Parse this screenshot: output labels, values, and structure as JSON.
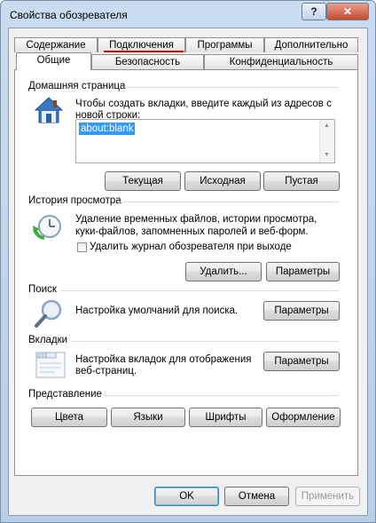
{
  "window": {
    "title": "Свойства обозревателя",
    "help_glyph": "?",
    "close_glyph": "✕"
  },
  "tabs_row1": [
    {
      "label": "Содержание"
    },
    {
      "label": "Подключения"
    },
    {
      "label": "Программы"
    },
    {
      "label": "Дополнительно"
    }
  ],
  "tabs_row2": [
    {
      "label": "Общие"
    },
    {
      "label": "Безопасность"
    },
    {
      "label": "Конфиденциальность"
    }
  ],
  "home": {
    "heading": "Домашняя страница",
    "description_line1": "Чтобы создать вкладки, введите каждый из адресов с",
    "description_line2": "новой строки:",
    "url_value": "about:blank",
    "buttons": {
      "current": "Текущая",
      "default": "Исходная",
      "blank": "Пустая"
    }
  },
  "history": {
    "heading": "История просмотра",
    "description_line1": "Удаление временных файлов, истории просмотра,",
    "description_line2": "куки-файлов, запомненных паролей и веб-форм.",
    "checkbox_label": "Удалить журнал обозревателя при выходе",
    "checkbox_checked": false,
    "buttons": {
      "delete": "Удалить...",
      "settings": "Параметры"
    }
  },
  "search": {
    "heading": "Поиск",
    "description": "Настройка умолчаний для поиска.",
    "settings_label": "Параметры"
  },
  "tabs_group": {
    "heading": "Вкладки",
    "description_line1": "Настройка вкладок для отображения",
    "description_line2": "веб-страниц.",
    "settings_label": "Параметры"
  },
  "appearance": {
    "heading": "Представление",
    "buttons": {
      "colors": "Цвета",
      "languages": "Языки",
      "fonts": "Шрифты",
      "accessibility": "Оформление"
    }
  },
  "footer": {
    "ok": "OK",
    "cancel": "Отмена",
    "apply": "Применить"
  },
  "colors": {
    "selection": "#3399ff",
    "underline_annotation": "#e00000"
  }
}
